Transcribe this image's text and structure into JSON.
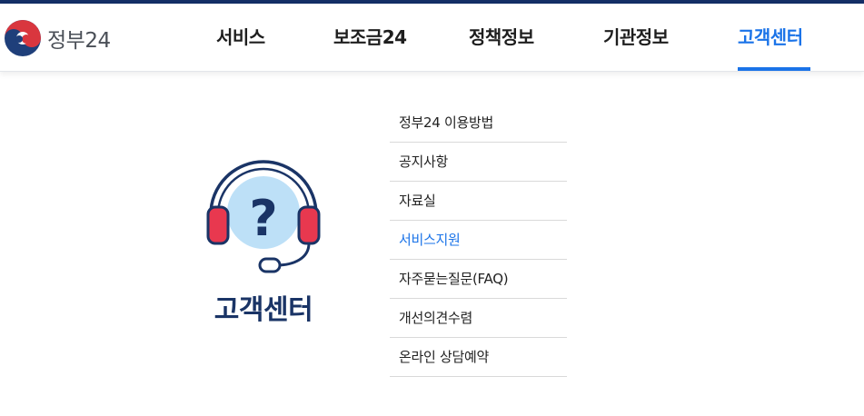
{
  "logo": {
    "text": "정부24",
    "icon": "taegeuk-emblem-icon"
  },
  "nav": {
    "items": [
      {
        "label": "서비스"
      },
      {
        "label": "보조금24"
      },
      {
        "label": "정책정보"
      },
      {
        "label": "기관정보"
      },
      {
        "label": "고객센터"
      }
    ],
    "active_index": 4
  },
  "hero": {
    "title": "고객센터",
    "icon": "headset-question-icon"
  },
  "submenu": {
    "items": [
      {
        "label": "정부24 이용방법"
      },
      {
        "label": "공지사항"
      },
      {
        "label": "자료실"
      },
      {
        "label": "서비스지원"
      },
      {
        "label": "자주묻는질문(FAQ)"
      },
      {
        "label": "개선의견수렴"
      },
      {
        "label": "온라인 상담예약"
      }
    ],
    "active_index": 3
  },
  "colors": {
    "brand_navy": "#142f66",
    "accent_blue": "#1a73e8",
    "headset_red": "#e8384f",
    "question_bubble": "#bde0f7"
  }
}
